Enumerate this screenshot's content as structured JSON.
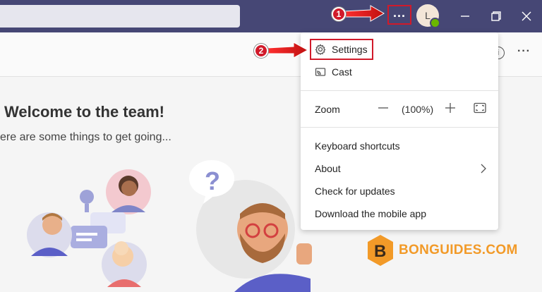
{
  "titlebar": {
    "more_label": "...",
    "avatar_initial": "L"
  },
  "welcome": {
    "title": "Welcome to the team!",
    "subtitle": "ere are some things to get going..."
  },
  "menu": {
    "settings_label": "Settings",
    "cast_label": "Cast",
    "zoom_label": "Zoom",
    "zoom_value": "(100%)",
    "keyboard_shortcuts_label": "Keyboard shortcuts",
    "about_label": "About",
    "check_updates_label": "Check for updates",
    "download_app_label": "Download the mobile app"
  },
  "annotations": {
    "step1": "1",
    "step2": "2"
  },
  "watermark": {
    "text": "BONGUIDES.COM",
    "letter": "B"
  },
  "colors": {
    "titlebar": "#464775",
    "highlight": "#d11a2a",
    "watermark": "#f29a28"
  }
}
